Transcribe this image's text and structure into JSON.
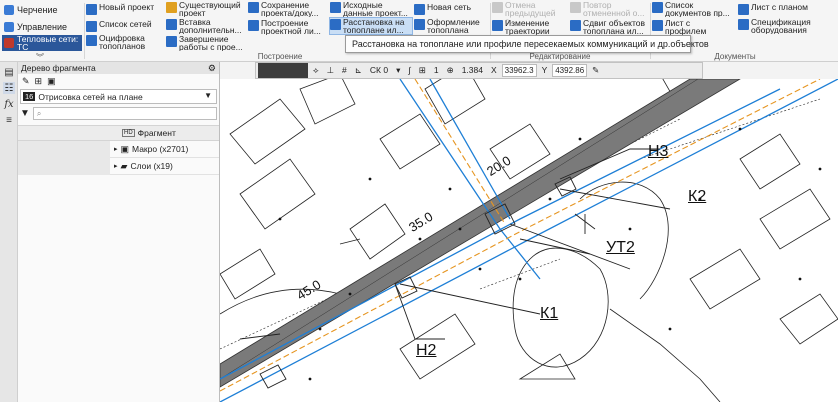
{
  "modes": [
    {
      "label": "Черчение",
      "active": false
    },
    {
      "label": "Управление",
      "active": false
    },
    {
      "label": "Тепловые сети: ТС",
      "active": true
    }
  ],
  "ribbon": {
    "items": [
      {
        "label": "Новый проект",
        "color": "#2b6cc4"
      },
      {
        "label": "Список сетей",
        "color": "#2b6cc4"
      },
      {
        "label": "Оцифровка топопланов",
        "color": "#2b6cc4"
      },
      {
        "label": "Существующий проект",
        "color": "#e0a020"
      },
      {
        "label": "Вставка дополнительн...",
        "color": "#2b6cc4"
      },
      {
        "label": "Завершение работы с прое...",
        "color": "#2b6cc4"
      },
      {
        "label": "Сохранение проекта/доку...",
        "color": "#2b6cc4"
      },
      {
        "label": "Построение проектной ли...",
        "color": "#2b6cc4"
      },
      {
        "label": "Исходные данные проект...",
        "color": "#2b6cc4"
      },
      {
        "label": "Расстановка на топоплане ил...",
        "color": "#2b6cc4"
      },
      {
        "label": "Новая сеть",
        "color": "#2b6cc4"
      },
      {
        "label": "Оформление топоплана ил...",
        "color": "#2b6cc4"
      },
      {
        "label": "Отмена предыдущей о...",
        "color": "#b8b8b8"
      },
      {
        "label": "Изменение траектории сети",
        "color": "#2b6cc4"
      },
      {
        "label": "Повтор отмененной о...",
        "color": "#b8b8b8"
      },
      {
        "label": "Сдвиг объектов топоплана ил...",
        "color": "#2b6cc4"
      },
      {
        "label": "Список документов пр...",
        "color": "#2b6cc4"
      },
      {
        "label": "Лист с профилем",
        "color": "#2b6cc4"
      },
      {
        "label": "Лист с планом",
        "color": "#2b6cc4"
      },
      {
        "label": "Спецификация оборудования",
        "color": "#2b6cc4"
      }
    ],
    "groups": [
      "Построение",
      "Редактирование",
      "Документы"
    ],
    "collapse_icon": "chevron-double-down-icon"
  },
  "tooltip": "Расстановка на топоплане или профиле пересекаемых коммуникаций и др.объектов",
  "panel": {
    "title": "Дерево фрагмента",
    "layer_number": "16",
    "layer_name": "Отрисовка сетей на плане",
    "column_header": "Фрагмент",
    "rows": [
      {
        "label": "Макро (x2701)",
        "icon": "macro-icon"
      },
      {
        "label": "Слои (x19)",
        "icon": "folder-icon"
      }
    ]
  },
  "toolbar": {
    "cs": "СК 0",
    "style": "1",
    "zoom": "1.384",
    "x_label": "X",
    "x_value": "33962.3",
    "y_label": "Y",
    "y_value": "4392.86"
  },
  "drawing": {
    "pipe_color": "#1e7fd6",
    "accent_orange": "#e69520",
    "road_color": "#7a7a7a",
    "labels": {
      "n3": "Н3",
      "k2": "К2",
      "ut2": "УТ2",
      "k1": "К1",
      "n2": "Н2",
      "d20": "20.0",
      "d35": "35.0",
      "d45": "45.0"
    }
  }
}
